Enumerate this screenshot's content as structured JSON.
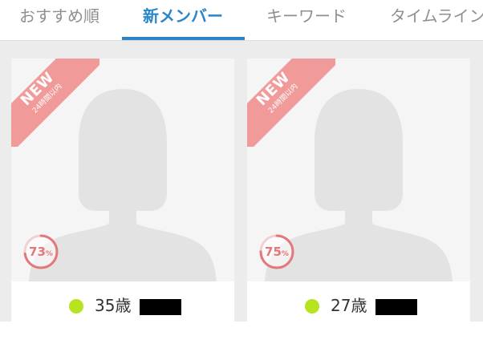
{
  "tabs": [
    {
      "label": "おすすめ順",
      "active": false
    },
    {
      "label": "新メンバー",
      "active": true
    },
    {
      "label": "キーワード",
      "active": false
    },
    {
      "label": "タイムライン",
      "active": false
    }
  ],
  "colors": {
    "accent": "#2a86c9",
    "ribbon": "#ef8b8b",
    "match": "#e4777b",
    "online": "#b7e31f"
  },
  "cards": [
    {
      "badge": "NEW",
      "badge_sub": "24時間以内",
      "match_value": "73",
      "match_unit": "%",
      "match_level": 0.73,
      "age": "35歳",
      "online_icon": "online-status-dot"
    },
    {
      "badge": "NEW",
      "badge_sub": "24時間以内",
      "match_value": "75",
      "match_unit": "%",
      "match_level": 0.75,
      "age": "27歳",
      "online_icon": "online-status-dot"
    }
  ]
}
